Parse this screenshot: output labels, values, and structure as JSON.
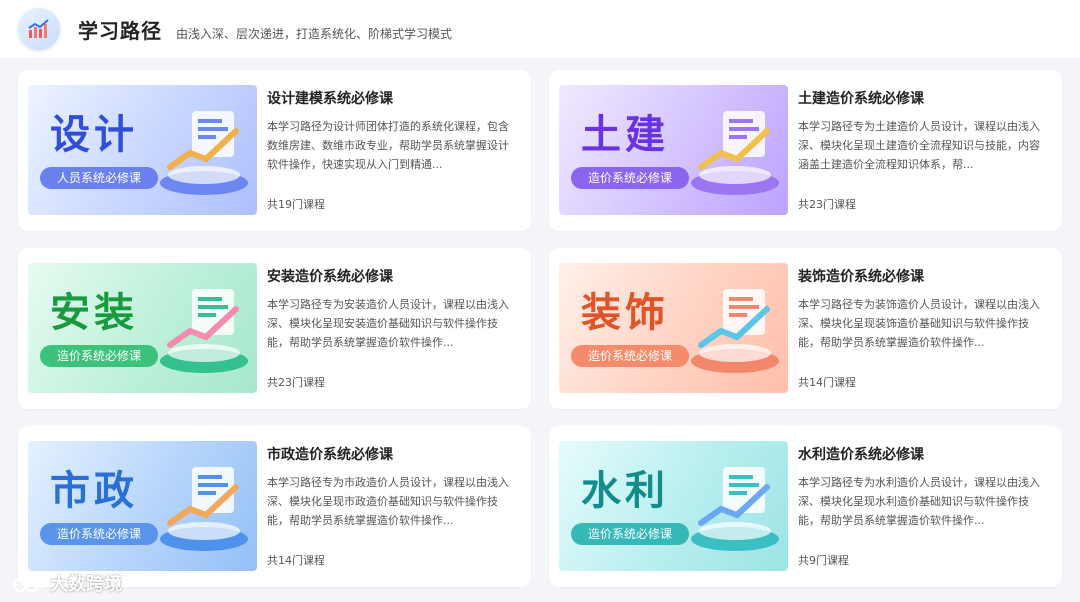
{
  "header": {
    "title": "学习路径",
    "subtitle": "由浅入深、层次递进，打造系统化、阶梯式学习模式"
  },
  "cards": [
    {
      "big": "设计",
      "tag": "人员系统必修课",
      "title": "设计建模系统必修课",
      "desc": "本学习路径为设计师团体打造的系统化课程，包含数维房建、数维市政专业，帮助学员系统掌握设计软件操作，快速实现从入门到精通...",
      "count": "共19门课程",
      "colors": {
        "text": "#2f4fd8",
        "tag": "#6a80ee",
        "base": "#6d87f2",
        "arrow": "#f0b04a"
      }
    },
    {
      "big": "土建",
      "tag": "造价系统必修课",
      "title": "土建造价系统必修课",
      "desc": "本学习路径专为土建造价人员设计，课程以由浅入深、模块化呈现土建造价全流程知识与技能，内容涵盖土建造价全流程知识体系，帮...",
      "count": "共23门课程",
      "colors": {
        "text": "#6a33e0",
        "tag": "#8a66ee",
        "base": "#9a76f2",
        "arrow": "#f0c04a"
      }
    },
    {
      "big": "安装",
      "tag": "造价系统必修课",
      "title": "安装造价系统必修课",
      "desc": "本学习路径专为安装造价人员设计，课程以由浅入深、模块化呈现安装造价基础知识与软件操作技能，帮助学员系统掌握造价软件操作...",
      "count": "共23门课程",
      "colors": {
        "text": "#1a9a3e",
        "tag": "#3cc27a",
        "base": "#34c08f",
        "arrow": "#f58bb0"
      }
    },
    {
      "big": "装饰",
      "tag": "造价系统必修课",
      "title": "装饰造价系统必修课",
      "desc": "本学习路径专为装饰造价人员设计，课程以由浅入深、模块化呈现装饰造价基础知识与软件操作技能，帮助学员系统掌握造价软件操作...",
      "count": "共14门课程",
      "colors": {
        "text": "#e0542a",
        "tag": "#f58b6a",
        "base": "#f2876b",
        "arrow": "#5bc6e6"
      }
    },
    {
      "big": "市政",
      "tag": "造价系统必修课",
      "title": "市政造价系统必修课",
      "desc": "本学习路径专为市政造价人员设计，课程以由浅入深、模块化呈现市政造价基础知识与软件操作技能，帮助学员系统掌握造价软件操作...",
      "count": "共14门课程",
      "colors": {
        "text": "#2a6fd8",
        "tag": "#5a95ec",
        "base": "#4f92ec",
        "arrow": "#f0a85a"
      }
    },
    {
      "big": "水利",
      "tag": "造价系统必修课",
      "title": "水利造价系统必修课",
      "desc": "本学习路径专为水利造价人员设计，课程以由浅入深、模块化呈现水利造价基础知识与软件操作技能，帮助学员系统掌握造价软件操作...",
      "count": "共9门课程",
      "colors": {
        "text": "#138c8c",
        "tag": "#35b8b8",
        "base": "#3bbfc3",
        "arrow": "#6aa8f0"
      }
    }
  ],
  "watermark": "大数跨境"
}
